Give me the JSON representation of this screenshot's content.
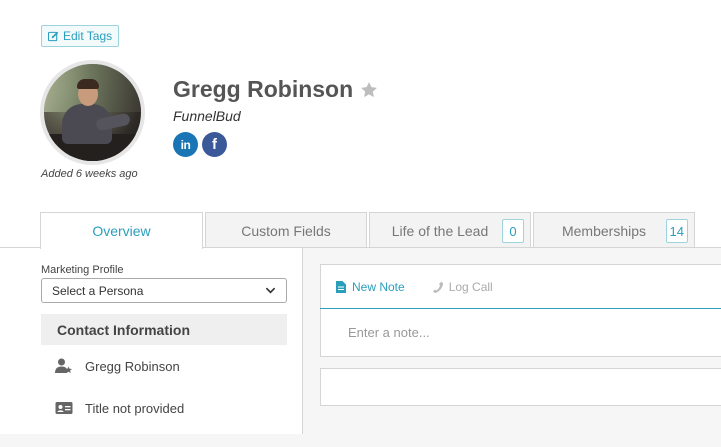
{
  "header": {
    "edit_tags_label": "Edit Tags",
    "contact_name": "Gregg Robinson",
    "company": "FunnelBud",
    "added": "Added 6 weeks ago",
    "socials": {
      "linkedin": "in",
      "facebook": "f"
    }
  },
  "tabs": [
    {
      "label": "Overview",
      "active": true
    },
    {
      "label": "Custom Fields"
    },
    {
      "label": "Life of the Lead",
      "count": "0"
    },
    {
      "label": "Memberships",
      "count": "14"
    }
  ],
  "sidebar": {
    "marketing_profile_label": "Marketing Profile",
    "persona_value": "Select a Persona",
    "contact_info_header": "Contact Information",
    "rows": [
      {
        "icon": "person-star-icon",
        "text": "Gregg Robinson"
      },
      {
        "icon": "id-card-icon",
        "text": "Title not provided"
      }
    ]
  },
  "notes": {
    "new_note_label": "New Note",
    "log_call_label": "Log Call",
    "placeholder": "Enter a note..."
  },
  "colors": {
    "accent": "#2a9fbc",
    "linkedin": "#1a75b4",
    "facebook": "#3b5998"
  }
}
